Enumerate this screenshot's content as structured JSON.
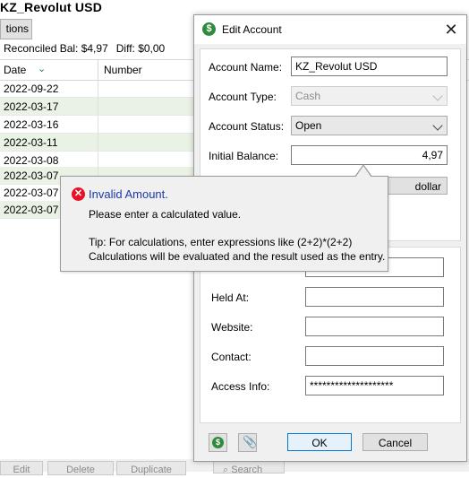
{
  "background": {
    "title": "KZ_Revolut USD",
    "options_label": "tions",
    "reconciled": "Reconciled Bal: $4,97",
    "diff": "Diff: $0,00",
    "columns": {
      "date": "Date",
      "number": "Number"
    },
    "rows": [
      "2022-09-22",
      "2022-03-17",
      "2022-03-16",
      "2022-03-11",
      "2022-03-08",
      "2022-03-07",
      "2022-03-07",
      "2022-03-07"
    ],
    "bottom_buttons": [
      "Edit",
      "Delete",
      "Duplicate",
      "Search"
    ]
  },
  "dialog": {
    "title": "Edit Account",
    "fields": {
      "account_name": {
        "label": "Account Name:",
        "value": "KZ_Revolut USD"
      },
      "account_type": {
        "label": "Account Type:",
        "value": "Cash"
      },
      "account_status": {
        "label": "Account Status:",
        "value": "Open"
      },
      "initial_balance": {
        "label": "Initial Balance:",
        "value": "4,97"
      },
      "currency": {
        "value": "dollar"
      },
      "held_at": {
        "label": "Held At:",
        "value": ""
      },
      "website": {
        "label": "Website:",
        "value": ""
      },
      "contact": {
        "label": "Contact:",
        "value": ""
      },
      "access_info": {
        "label": "Access Info:",
        "value": "********************"
      }
    },
    "ok_label": "OK",
    "cancel_label": "Cancel"
  },
  "tooltip": {
    "title": "Invalid Amount.",
    "line1": "Please enter a calculated value.",
    "line2": "Tip: For calculations, enter expressions like (2+2)*(2+2)",
    "line3": "Calculations will be evaluated and the result used as the entry."
  },
  "colors": {
    "accent": "#0078d7",
    "error": "#e81123",
    "money_green": "#2f8a3c",
    "tooltip_title": "#1c3aa9"
  }
}
